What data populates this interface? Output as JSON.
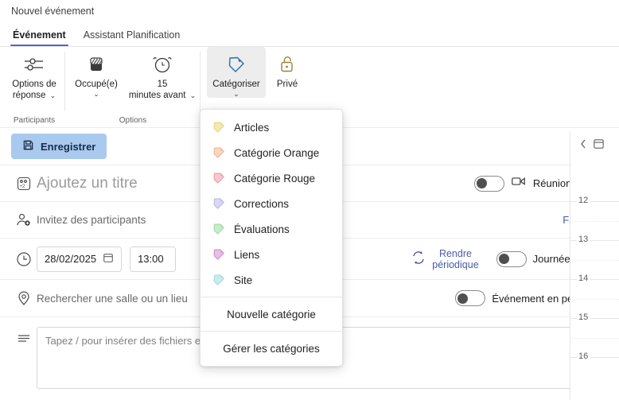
{
  "window": {
    "title": "Nouvel événement"
  },
  "tabs": [
    {
      "label": "Événement",
      "active": true
    },
    {
      "label": "Assistant Planification",
      "active": false
    }
  ],
  "ribbon": {
    "groups": [
      {
        "label": "Participants",
        "buttons": [
          {
            "name": "response-options",
            "label": "Options de réponse",
            "icon": "sliders-icon",
            "chevron": true,
            "active": false
          }
        ]
      },
      {
        "label": "Options",
        "buttons": [
          {
            "name": "busy-status",
            "label": "Occupé(e)",
            "icon": "busy-icon",
            "chevron": true,
            "active": false
          },
          {
            "name": "reminder",
            "label": "15 minutes avant",
            "icon": "alarm-clock-icon",
            "chevron": true,
            "active": false
          }
        ]
      },
      {
        "label": "",
        "buttons": [
          {
            "name": "categorize",
            "label": "Catégoriser",
            "icon": "tag-icon",
            "chevron": true,
            "active": true
          },
          {
            "name": "private",
            "label": "Privé",
            "icon": "unlock-icon",
            "chevron": false,
            "active": false
          }
        ]
      }
    ]
  },
  "actionbar": {
    "save_label": "Enregistrer",
    "save_icon": "save-icon"
  },
  "form": {
    "title_placeholder": "Ajoutez un titre",
    "title_value": "",
    "title_icon": "people-add-icon",
    "teams_toggle_label": "Réunion Teams",
    "teams_icon": "video-camera-icon",
    "attendees_placeholder": "Invitez des participants",
    "attendees_value": "",
    "attendees_icon": "person-add-icon",
    "optional_link": "Facultatif",
    "clock_icon": "clock-icon",
    "date_value": "28/02/2025",
    "date_icon": "calendar-icon",
    "time_value": "13:00",
    "recurrence_label": "Rendre périodique",
    "recurrence_icon": "repeat-icon",
    "allday_label": "Journée entière",
    "location_placeholder": "Rechercher une salle ou un lieu",
    "location_value": "",
    "location_icon": "location-pin-icon",
    "inperson_label": "Événement en personne",
    "body_icon": "text-lines-icon",
    "body_placeholder": "Tapez / pour insérer des fichiers et plus encore"
  },
  "calendar_strip": {
    "prev_icon": "chevron-left-icon",
    "calendar_icon": "calendar-icon",
    "hours": [
      "12",
      "13",
      "14",
      "15",
      "16"
    ]
  },
  "dropdown": {
    "categories": [
      {
        "label": "Articles",
        "color": "#e9d77e"
      },
      {
        "label": "Catégorie Orange",
        "color": "#f0b68f"
      },
      {
        "label": "Catégorie Rouge",
        "color": "#f09aa8"
      },
      {
        "label": "Corrections",
        "color": "#b9b6e8"
      },
      {
        "label": "Évaluations",
        "color": "#9fd9a3"
      },
      {
        "label": "Liens",
        "color": "#d08ecd"
      },
      {
        "label": "Site",
        "color": "#9fdbe0"
      }
    ],
    "new_category": "Nouvelle catégorie",
    "manage_categories": "Gérer les catégories"
  },
  "colors": {
    "accent": "#5b5fc7",
    "save_bg": "#a9c9ef",
    "link": "#4a5aa8"
  }
}
